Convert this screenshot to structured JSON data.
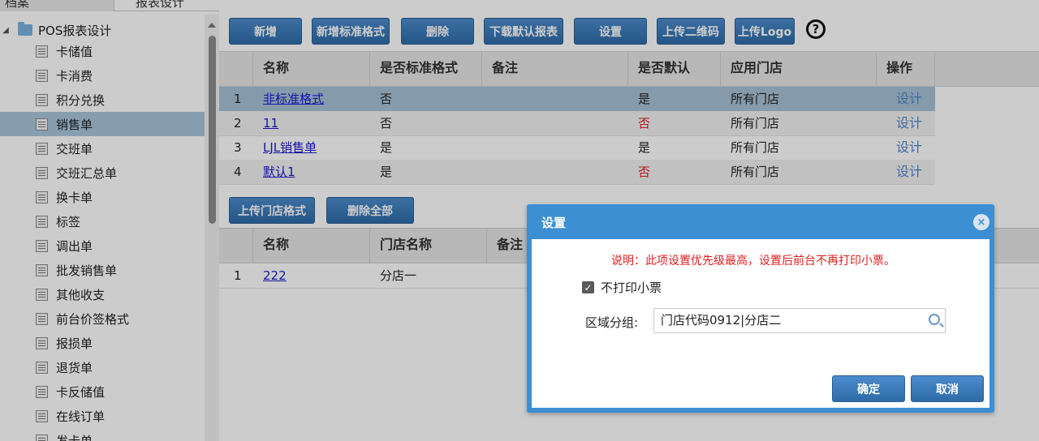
{
  "tabs": [
    {
      "label": "档案"
    },
    {
      "label": "报表设计"
    }
  ],
  "tree": {
    "root": "POS报表设计",
    "items": [
      "卡储值",
      "卡消费",
      "积分兑换",
      "销售单",
      "交班单",
      "交班汇总单",
      "换卡单",
      "标签",
      "调出单",
      "批发销售单",
      "其他收支",
      "前台价签格式",
      "报损单",
      "退货单",
      "卡反储值",
      "在线订单",
      "发卡单"
    ],
    "selected_index": 3
  },
  "toolbar": {
    "buttons": [
      "新增",
      "新增标准格式",
      "删除",
      "下载默认报表",
      "设置",
      "上传二维码",
      "上传Logo"
    ],
    "help": "?"
  },
  "table1": {
    "headers": [
      "名称",
      "是否标准格式",
      "备注",
      "是否默认",
      "应用门店",
      "操作"
    ],
    "rows": [
      {
        "num": "1",
        "name": "非标准格式",
        "std": "否",
        "note": "",
        "def": "是",
        "store": "所有门店",
        "op": "设计"
      },
      {
        "num": "2",
        "name": "11",
        "std": "否",
        "note": "",
        "def": "否",
        "store": "所有门店",
        "op": "设计"
      },
      {
        "num": "3",
        "name": "LJL销售单",
        "std": "是",
        "note": "",
        "def": "是",
        "store": "所有门店",
        "op": "设计"
      },
      {
        "num": "4",
        "name": "默认1",
        "std": "是",
        "note": "",
        "def": "否",
        "store": "所有门店",
        "op": "设计"
      }
    ]
  },
  "store_buttons": [
    "上传门店格式",
    "删除全部"
  ],
  "table2": {
    "headers": [
      "名称",
      "门店名称",
      "备注"
    ],
    "rows": [
      {
        "num": "1",
        "name": "222",
        "store": "分店一",
        "note": ""
      }
    ]
  },
  "dialog": {
    "title": "设置",
    "close": "×",
    "note": "说明：此项设置优先级最高，设置后前台不再打印小票。",
    "checkbox_label": "不打印小票",
    "checkbox_checked": true,
    "region_label": "区域分组:",
    "region_value": "门店代码0912|分店二",
    "ok": "确定",
    "cancel": "取消"
  },
  "colors": {
    "accent": "#3d8fd3",
    "button": "#2e6ca8",
    "selected_row": "#a7c2d8",
    "red": "#e02020",
    "link": "#1a1ad0"
  }
}
